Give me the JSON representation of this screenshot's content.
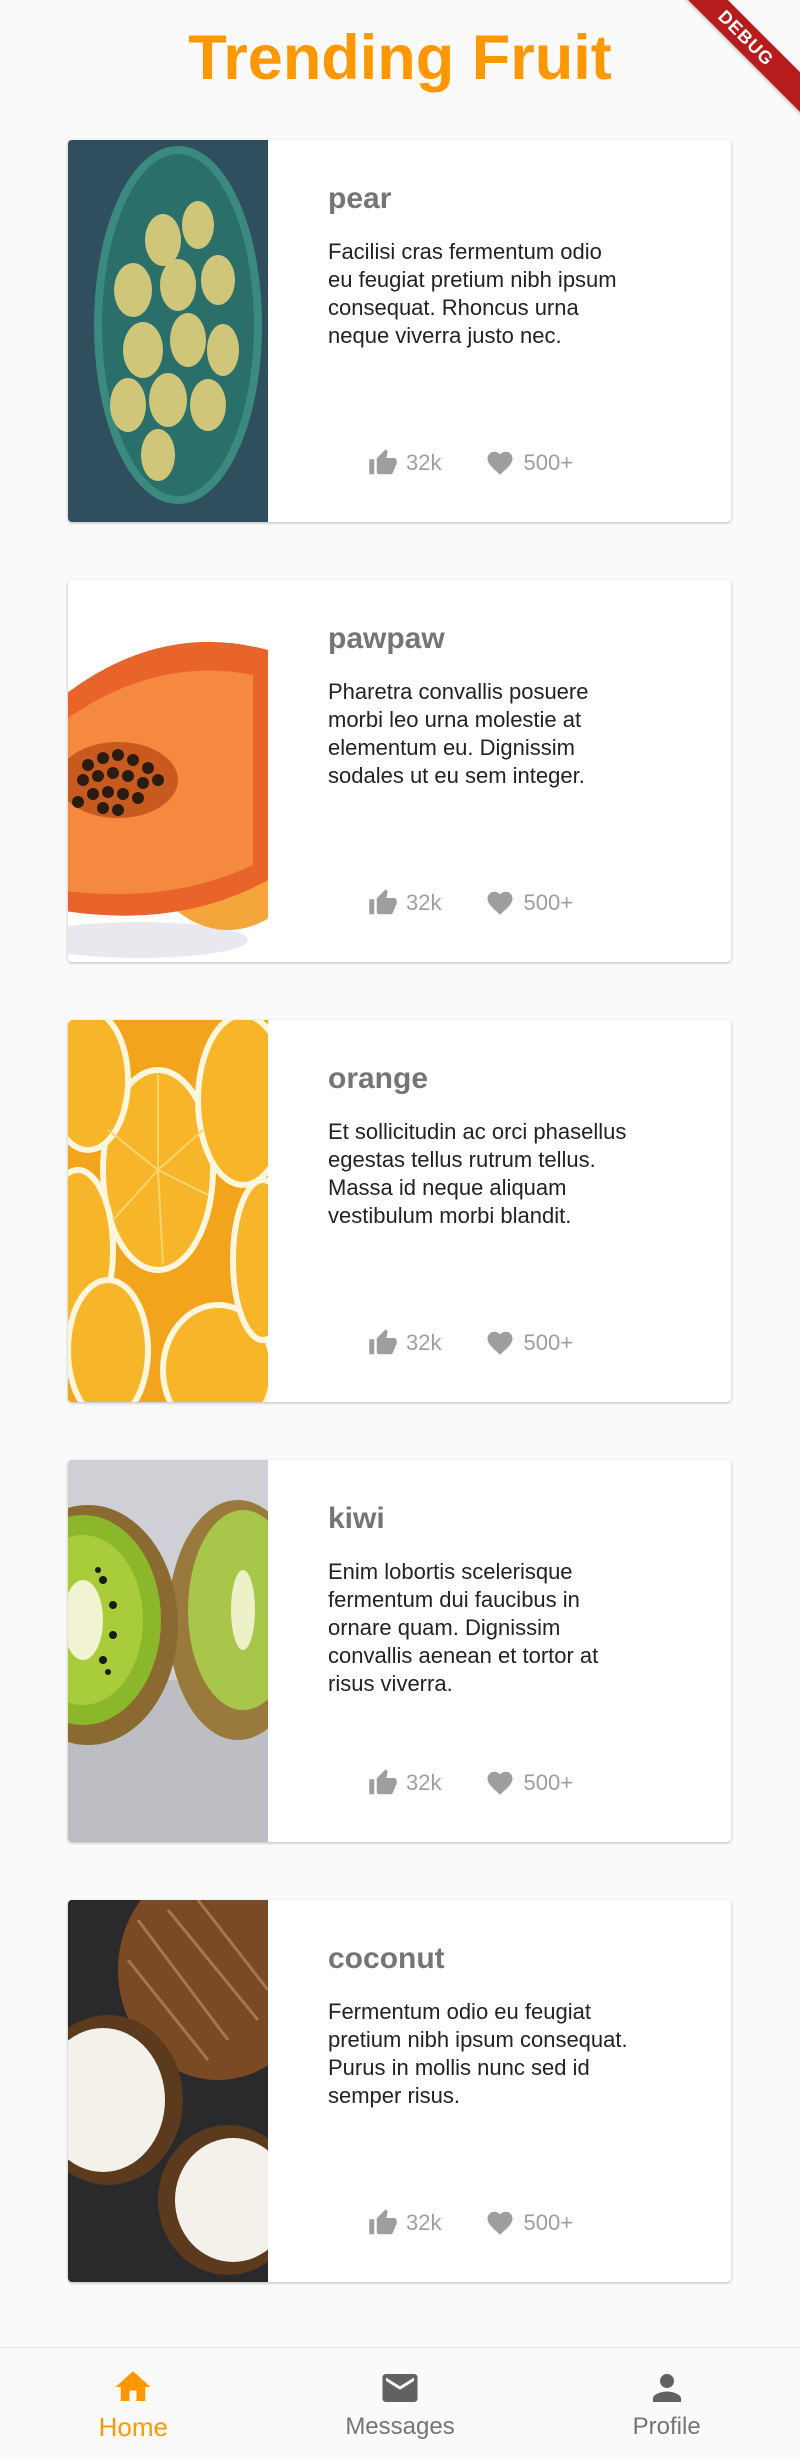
{
  "header": {
    "title": "Trending Fruit"
  },
  "debug_banner": "DEBUG",
  "colors": {
    "accent": "#ff9800",
    "title_gray": "#757575",
    "stat_gray": "#9e9e9e",
    "background": "#fafafa"
  },
  "cards": [
    {
      "title": "pear",
      "description": "Facilisi cras fermentum odio eu feugiat pretium nibh ipsum consequat. Rhoncus urna neque viverra justo nec.",
      "likes": "32k",
      "favorites": "500+",
      "image": "pear-photo"
    },
    {
      "title": "pawpaw",
      "description": "Pharetra convallis posuere morbi leo urna molestie at elementum eu. Dignissim sodales ut eu sem integer.",
      "likes": "32k",
      "favorites": "500+",
      "image": "papaya-photo"
    },
    {
      "title": "orange",
      "description": "Et sollicitudin ac orci phasellus egestas tellus rutrum tellus. Massa id neque aliquam vestibulum morbi blandit.",
      "likes": "32k",
      "favorites": "500+",
      "image": "orange-slices-photo"
    },
    {
      "title": "kiwi",
      "description": "Enim lobortis scelerisque fermentum dui faucibus in ornare quam. Dignissim convallis aenean et tortor at risus viverra.",
      "likes": "32k",
      "favorites": "500+",
      "image": "kiwi-photo"
    },
    {
      "title": "coconut",
      "description": "Fermentum odio eu feugiat pretium nibh ipsum consequat. Purus in mollis nunc sed id semper risus.",
      "likes": "32k",
      "favorites": "500+",
      "image": "coconut-photo"
    }
  ],
  "bottom_nav": {
    "items": [
      {
        "label": "Home",
        "icon": "home-icon",
        "active": true
      },
      {
        "label": "Messages",
        "icon": "mail-icon",
        "active": false
      },
      {
        "label": "Profile",
        "icon": "person-icon",
        "active": false
      }
    ]
  }
}
